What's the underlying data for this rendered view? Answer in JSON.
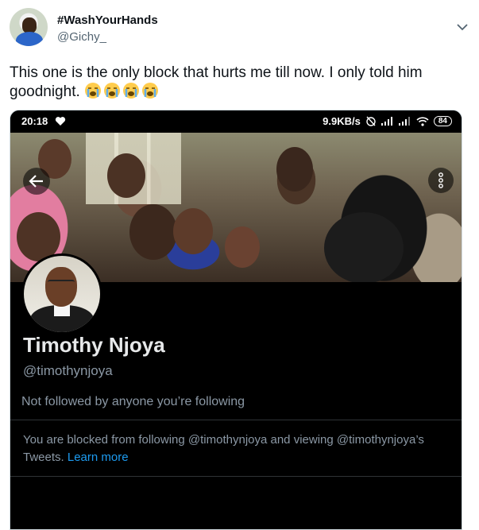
{
  "tweet": {
    "display_name": "#WashYourHands",
    "handle": "@Gichy_",
    "text": "This one is the only block that hurts me till now. I only told him goodnight."
  },
  "screenshot": {
    "status_bar": {
      "time": "20:18",
      "network_speed": "9.9KB/s",
      "battery": "84"
    },
    "profile": {
      "name": "Timothy Njoya",
      "handle": "@timothynjoya",
      "followed_note": "Not followed by anyone you’re following",
      "blocked_message": "You are blocked from following @timothynjoya and viewing @timothynjoya’s Tweets.",
      "learn_more": "Learn more"
    }
  },
  "colors": {
    "link": "#1d9bf0",
    "dark_bg": "#000000",
    "muted_text": "#8b98a5"
  }
}
